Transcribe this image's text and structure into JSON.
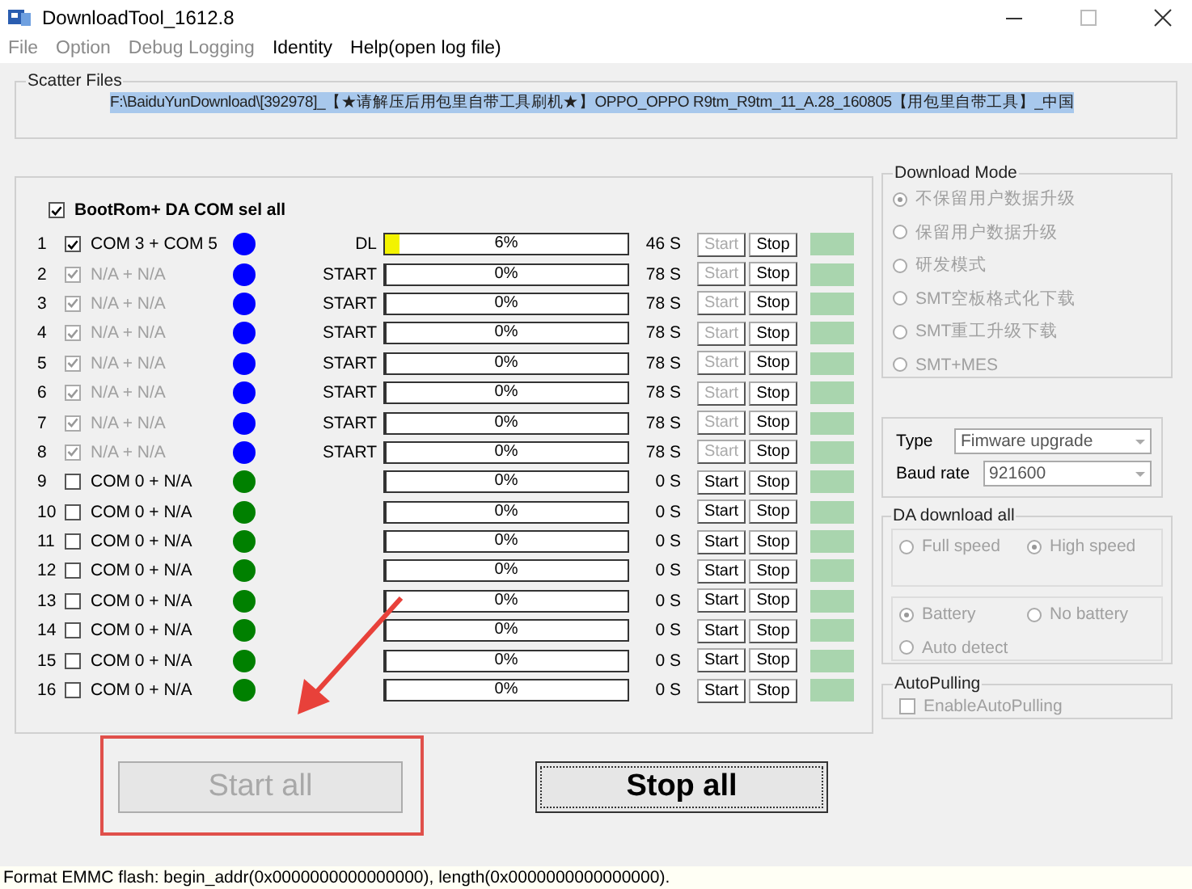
{
  "window": {
    "title": "DownloadTool_1612.8"
  },
  "menu": [
    {
      "label": "File",
      "disabled": true
    },
    {
      "label": "Option",
      "disabled": true
    },
    {
      "label": "Debug Logging",
      "disabled": true
    },
    {
      "label": "Identity",
      "disabled": false
    },
    {
      "label": "Help(open log file)",
      "disabled": false
    }
  ],
  "scatter_files": {
    "title": "Scatter Files",
    "value": "F:\\BaiduYunDownload\\[392978]_【★请解压后用包里自带工具刷机★】OPPO_OPPO R9tm_R9tm_11_A.28_160805【用包里自带工具】_中国",
    "selected": true
  },
  "sel_all": {
    "label": "BootRom+ DA COM sel all",
    "checked": true
  },
  "ports": [
    {
      "index": "1",
      "checked": true,
      "disabled": false,
      "port": "COM 3 + COM 5",
      "color": "#0000ff",
      "status": "DL",
      "level": 0.06,
      "percent": "6%",
      "time": "46 S",
      "start_disabled": true,
      "start": "Start",
      "stop": "Stop"
    },
    {
      "index": "2",
      "checked": true,
      "disabled": true,
      "port": "N/A + N/A",
      "color": "#0000ff",
      "status": "START",
      "level": 0,
      "percent": "0%",
      "time": "78 S",
      "start_disabled": true,
      "start": "Start",
      "stop": "Stop"
    },
    {
      "index": "3",
      "checked": true,
      "disabled": true,
      "port": "N/A + N/A",
      "color": "#0000ff",
      "status": "START",
      "level": 0,
      "percent": "0%",
      "time": "78 S",
      "start_disabled": true,
      "start": "Start",
      "stop": "Stop"
    },
    {
      "index": "4",
      "checked": true,
      "disabled": true,
      "port": "N/A + N/A",
      "color": "#0000ff",
      "status": "START",
      "level": 0,
      "percent": "0%",
      "time": "78 S",
      "start_disabled": true,
      "start": "Start",
      "stop": "Stop"
    },
    {
      "index": "5",
      "checked": true,
      "disabled": true,
      "port": "N/A + N/A",
      "color": "#0000ff",
      "status": "START",
      "level": 0,
      "percent": "0%",
      "time": "78 S",
      "start_disabled": true,
      "start": "Start",
      "stop": "Stop"
    },
    {
      "index": "6",
      "checked": true,
      "disabled": true,
      "port": "N/A + N/A",
      "color": "#0000ff",
      "status": "START",
      "level": 0,
      "percent": "0%",
      "time": "78 S",
      "start_disabled": true,
      "start": "Start",
      "stop": "Stop"
    },
    {
      "index": "7",
      "checked": true,
      "disabled": true,
      "port": "N/A + N/A",
      "color": "#0000ff",
      "status": "START",
      "level": 0,
      "percent": "0%",
      "time": "78 S",
      "start_disabled": true,
      "start": "Start",
      "stop": "Stop"
    },
    {
      "index": "8",
      "checked": true,
      "disabled": true,
      "port": "N/A + N/A",
      "color": "#0000ff",
      "status": "START",
      "level": 0,
      "percent": "0%",
      "time": "78 S",
      "start_disabled": true,
      "start": "Start",
      "stop": "Stop"
    },
    {
      "index": "9",
      "checked": false,
      "disabled": false,
      "port": "COM 0 + N/A",
      "color": "#008000",
      "level": 0,
      "percent": "0%",
      "time": "0 S",
      "start_disabled": false,
      "start": "Start",
      "stop": "Stop"
    },
    {
      "index": "10",
      "checked": false,
      "disabled": false,
      "port": "COM 0 + N/A",
      "color": "#008000",
      "level": 0,
      "percent": "0%",
      "time": "0 S",
      "start_disabled": false,
      "start": "Start",
      "stop": "Stop"
    },
    {
      "index": "11",
      "checked": false,
      "disabled": false,
      "port": "COM 0 + N/A",
      "color": "#008000",
      "level": 0,
      "percent": "0%",
      "time": "0 S",
      "start_disabled": false,
      "start": "Start",
      "stop": "Stop"
    },
    {
      "index": "12",
      "checked": false,
      "disabled": false,
      "port": "COM 0 + N/A",
      "color": "#008000",
      "level": 0,
      "percent": "0%",
      "time": "0 S",
      "start_disabled": false,
      "start": "Start",
      "stop": "Stop"
    },
    {
      "index": "13",
      "checked": false,
      "disabled": false,
      "port": "COM 0 + N/A",
      "color": "#008000",
      "level": 0,
      "percent": "0%",
      "time": "0 S",
      "start_disabled": false,
      "start": "Start",
      "stop": "Stop"
    },
    {
      "index": "14",
      "checked": false,
      "disabled": false,
      "port": "COM 0 + N/A",
      "color": "#008000",
      "level": 0,
      "percent": "0%",
      "time": "0 S",
      "start_disabled": false,
      "start": "Start",
      "stop": "Stop"
    },
    {
      "index": "15",
      "checked": false,
      "disabled": false,
      "port": "COM 0 + N/A",
      "color": "#008000",
      "level": 0,
      "percent": "0%",
      "time": "0 S",
      "start_disabled": false,
      "start": "Start",
      "stop": "Stop"
    },
    {
      "index": "16",
      "checked": false,
      "disabled": false,
      "port": "COM 0 + N/A",
      "color": "#008000",
      "level": 0,
      "percent": "0%",
      "time": "0 S",
      "start_disabled": false,
      "start": "Start",
      "stop": "Stop"
    }
  ],
  "download_mode": {
    "title": "Download Mode",
    "disabled": true,
    "options": [
      {
        "label": "不保留用户数据升级",
        "selected": true
      },
      {
        "label": "保留用户数据升级",
        "selected": false
      },
      {
        "label": "研发模式",
        "selected": false
      },
      {
        "label": "SMT空板格式化下载",
        "selected": false
      },
      {
        "label": "SMT重工升级下载",
        "selected": false
      },
      {
        "label": "SMT+MES",
        "selected": false
      }
    ]
  },
  "settings": [
    {
      "label": "Type",
      "value": "Fimware upgrade"
    },
    {
      "label": "Baud rate",
      "value": "921600"
    }
  ],
  "da_download_all": {
    "title": "DA download all",
    "disabled": true,
    "speed": [
      {
        "label": "Full speed",
        "selected": false
      },
      {
        "label": "High speed",
        "selected": true
      }
    ],
    "power": [
      {
        "label": "Battery",
        "selected": true
      },
      {
        "label": "No battery",
        "selected": false
      },
      {
        "label": "Auto detect",
        "selected": false
      }
    ]
  },
  "auto_pulling": {
    "title": "AutoPulling",
    "label": "EnableAutoPulling",
    "checked": false,
    "disabled": true
  },
  "buttons": [
    {
      "label": "Start all",
      "disabled": true,
      "focused": false
    },
    {
      "label": "Stop all",
      "disabled": false,
      "focused": true
    }
  ],
  "status_bar": "Format EMMC flash:  begin_addr(0x0000000000000000), length(0x0000000000000000)."
}
